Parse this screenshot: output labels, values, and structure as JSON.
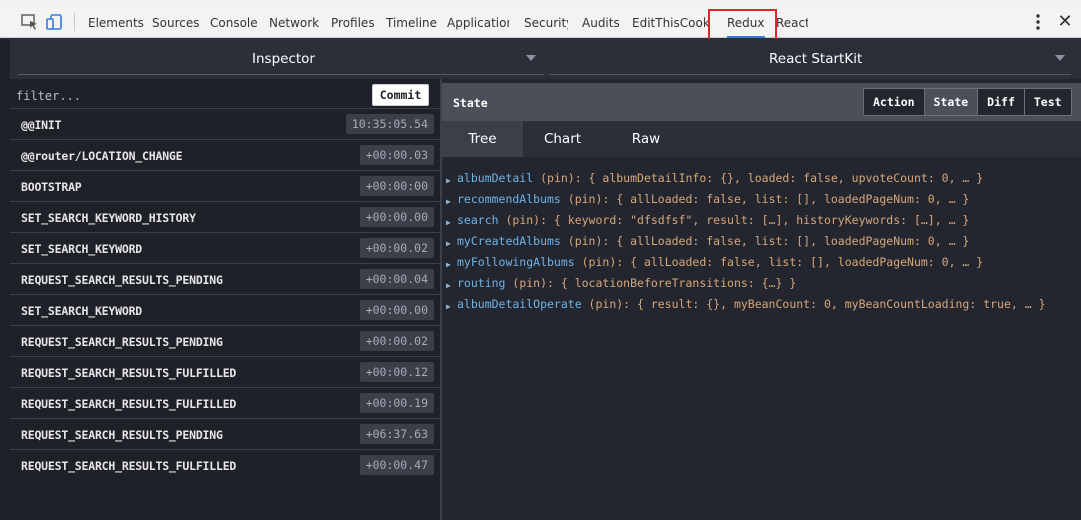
{
  "devtools": {
    "tabs": [
      "Elements",
      "Sources",
      "Console",
      "Network",
      "Profiles",
      "Timeline",
      "Application",
      "Security",
      "Audits",
      "EditThisCookie",
      "Redux",
      "React"
    ],
    "active_tab": "Redux",
    "colors": {
      "highlight_box": "#e0242b",
      "accent": "#3879d9"
    }
  },
  "inspector": {
    "title": "Inspector",
    "instance": "React StartKit"
  },
  "filter": {
    "placeholder": "filter...",
    "commit_label": "Commit"
  },
  "actions": [
    {
      "name": "@@INIT",
      "time": "10:35:05.54"
    },
    {
      "name": "@@router/LOCATION_CHANGE",
      "time": "+00:00.03"
    },
    {
      "name": "BOOTSTRAP",
      "time": "+00:00:00"
    },
    {
      "name": "SET_SEARCH_KEYWORD_HISTORY",
      "time": "+00:00.00"
    },
    {
      "name": "SET_SEARCH_KEYWORD",
      "time": "+00:00.02"
    },
    {
      "name": "REQUEST_SEARCH_RESULTS_PENDING",
      "time": "+00:00.04"
    },
    {
      "name": "SET_SEARCH_KEYWORD",
      "time": "+00:00.00"
    },
    {
      "name": "REQUEST_SEARCH_RESULTS_PENDING",
      "time": "+00:00.02"
    },
    {
      "name": "REQUEST_SEARCH_RESULTS_FULFILLED",
      "time": "+00:00.12"
    },
    {
      "name": "REQUEST_SEARCH_RESULTS_FULFILLED",
      "time": "+00:00.19"
    },
    {
      "name": "REQUEST_SEARCH_RESULTS_PENDING",
      "time": "+06:37.63"
    },
    {
      "name": "REQUEST_SEARCH_RESULTS_FULFILLED",
      "time": "+00:00.47"
    }
  ],
  "state_panel": {
    "label": "State",
    "modes": [
      "Action",
      "State",
      "Diff",
      "Test"
    ],
    "active_mode": "State",
    "views": [
      "Tree",
      "Chart",
      "Raw"
    ],
    "active_view": "Tree"
  },
  "tree": [
    {
      "key": "albumDetail",
      "value": " (pin): { albumDetailInfo: {}, loaded: false, upvoteCount: 0, … }"
    },
    {
      "key": "recommendAlbums",
      "value": " (pin): { allLoaded: false, list: [], loadedPageNum: 0, … }"
    },
    {
      "key": "search",
      "value": " (pin): { keyword: \"dfsdfsf\", result: […], historyKeywords: […], … }"
    },
    {
      "key": "myCreatedAlbums",
      "value": " (pin): { allLoaded: false, list: [], loadedPageNum: 0, … }"
    },
    {
      "key": "myFollowingAlbums",
      "value": " (pin): { allLoaded: false, list: [], loadedPageNum: 0, … }"
    },
    {
      "key": "routing",
      "value": " (pin): { locationBeforeTransitions: {…} }"
    },
    {
      "key": "albumDetailOperate",
      "value": " (pin): { result: {}, myBeanCount: 0, myBeanCountLoading: true, … }"
    }
  ]
}
